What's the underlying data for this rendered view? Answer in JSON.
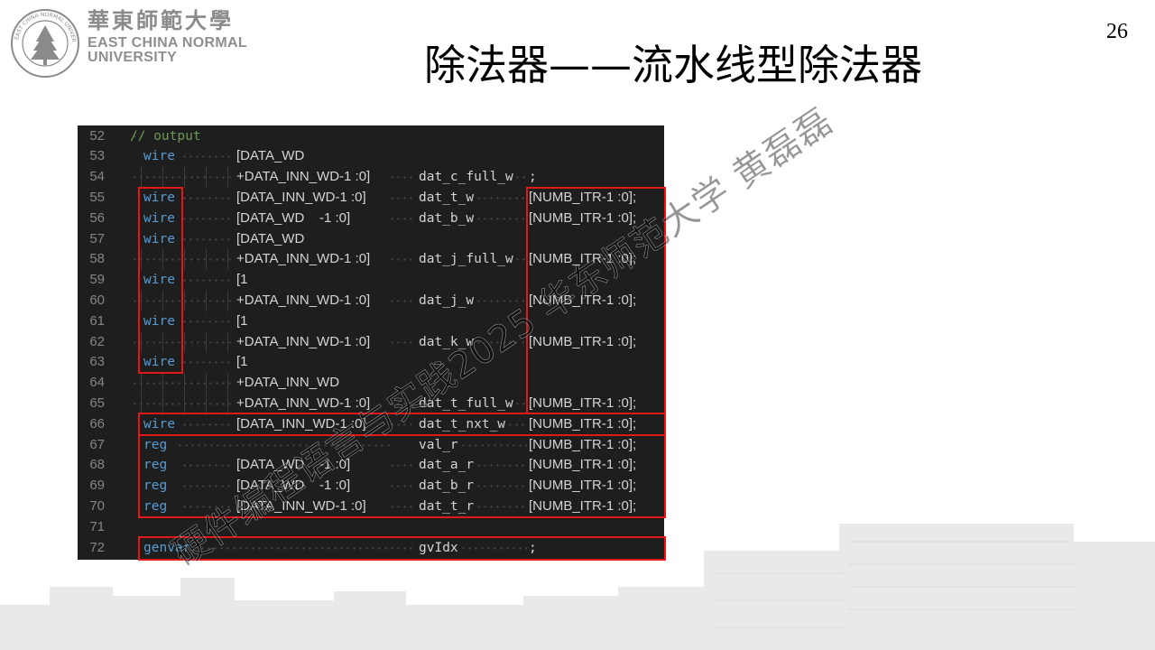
{
  "logo": {
    "name_cn": "華東師範大學",
    "name_en_line1": "EAST CHINA NORMAL",
    "name_en_line2": "UNIVERSITY",
    "seal_text": "EAST CHINA NORMAL UNIVERSITY"
  },
  "page_number": "26",
  "title": "除法器——流水线型除法器",
  "watermark": "硬件编程语言与实践2025 华东师范大学 黄磊磊",
  "code_lines": [
    {
      "ln": "52",
      "comment": "// output"
    },
    {
      "ln": "53",
      "kw": "wire",
      "range": "[DATA_WD"
    },
    {
      "ln": "54",
      "range": "+DATA_INN_WD-1 :0]",
      "name": "dat_c_full_w",
      "semi": ";"
    },
    {
      "ln": "55",
      "kw": "wire",
      "range": "[DATA_INN_WD-1 :0]",
      "name": "dat_t_w",
      "dim": "[NUMB_ITR-1 :0];"
    },
    {
      "ln": "56",
      "kw": "wire",
      "range": "[DATA_WD    -1 :0]",
      "name": "dat_b_w",
      "dim": "[NUMB_ITR-1 :0];"
    },
    {
      "ln": "57",
      "kw": "wire",
      "range": "[DATA_WD"
    },
    {
      "ln": "58",
      "range": "+DATA_INN_WD-1 :0]",
      "name": "dat_j_full_w",
      "dim": "[NUMB_ITR-1 :0];"
    },
    {
      "ln": "59",
      "kw": "wire",
      "range": "[1"
    },
    {
      "ln": "60",
      "range": "+DATA_INN_WD-1 :0]",
      "name": "dat_j_w",
      "dim": "[NUMB_ITR-1 :0];"
    },
    {
      "ln": "61",
      "kw": "wire",
      "range": "[1"
    },
    {
      "ln": "62",
      "range": "+DATA_INN_WD-1 :0]",
      "name": "dat_k_w",
      "dim": "[NUMB_ITR-1 :0];"
    },
    {
      "ln": "63",
      "kw": "wire",
      "range": "[1"
    },
    {
      "ln": "64",
      "range": "+DATA_INN_WD"
    },
    {
      "ln": "65",
      "range": "+DATA_INN_WD-1 :0]",
      "name": "dat_t_full_w",
      "dim": "[NUMB_ITR-1 :0];"
    },
    {
      "ln": "66",
      "kw": "wire",
      "range": "[DATA_INN_WD-1 :0]",
      "name": "dat_t_nxt_w",
      "dim": "[NUMB_ITR-1 :0];"
    },
    {
      "ln": "67",
      "kw": "reg",
      "name": "val_r",
      "dim": "[NUMB_ITR-1 :0];"
    },
    {
      "ln": "68",
      "kw": "reg",
      "range": "[DATA_WD    -1 :0]",
      "name": "dat_a_r",
      "dim": "[NUMB_ITR-1 :0];"
    },
    {
      "ln": "69",
      "kw": "reg",
      "range": "[DATA_WD    -1 :0]",
      "name": "dat_b_r",
      "dim": "[NUMB_ITR-1 :0];"
    },
    {
      "ln": "70",
      "kw": "reg",
      "range": "[DATA_INN_WD-1 :0]",
      "name": "dat_t_r",
      "dim": "[NUMB_ITR-1 :0];"
    },
    {
      "ln": "71"
    },
    {
      "ln": "72",
      "kw": "genvar",
      "name": "gvIdx",
      "semi": ";"
    }
  ],
  "colors": {
    "editor_bg": "#1e1e1e",
    "keyword": "#569cd6",
    "comment": "#6a9955",
    "line_number": "#858585",
    "highlight_box": "#e01818"
  }
}
